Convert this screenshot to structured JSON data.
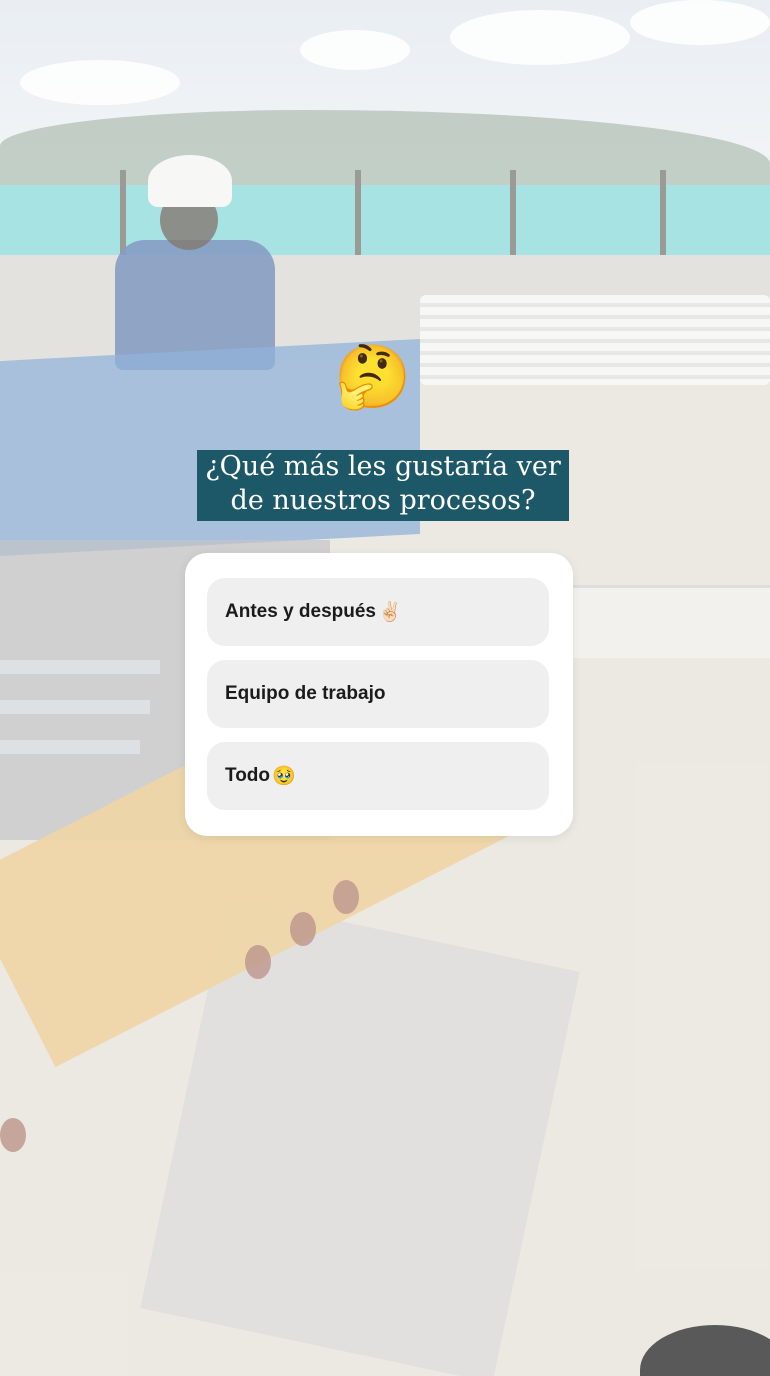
{
  "story": {
    "question_line1": "¿Qué más les gustaría ver",
    "question_line2": "de nuestros procesos?",
    "sticker_emoji": "🤔",
    "accent_color": "#1d5868"
  },
  "poll": {
    "options": [
      {
        "label": "Antes y después",
        "emoji": "✌🏻"
      },
      {
        "label": "Equipo de trabajo",
        "emoji": ""
      },
      {
        "label": "Todo",
        "emoji": "🥹"
      }
    ]
  }
}
